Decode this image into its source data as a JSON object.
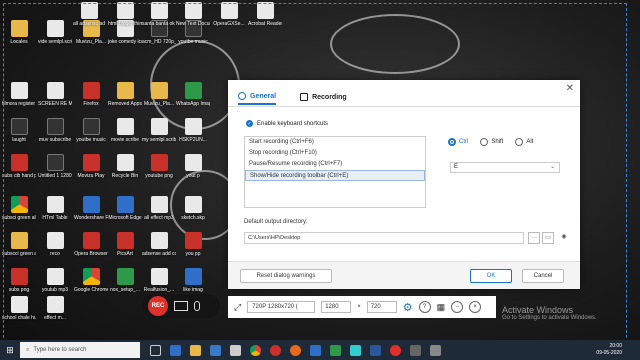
{
  "desktop": {
    "icons": [
      {
        "label": "Locales",
        "color": "c-folder"
      },
      {
        "label": "vide semlpl.scribe",
        "color": "c-file"
      },
      {
        "label": "Muvizu_Pla...",
        "color": "c-folder"
      },
      {
        "label": "joke comedy icon",
        "color": "c-file"
      },
      {
        "label": "acm_HD 720p_(1)",
        "color": "c-vid"
      },
      {
        "label": "youtbe music",
        "color": "c-vid"
      },
      {
        "label": "filmora register code",
        "color": "c-file"
      },
      {
        "label": "SCREEN RE MP3",
        "color": "c-file"
      },
      {
        "label": "Firefox",
        "color": "c-red"
      },
      {
        "label": "Removed Apps",
        "color": "c-folder"
      },
      {
        "label": "Muvizu_Pla...",
        "color": "c-folder"
      },
      {
        "label": "WhatsApp Image 2020...",
        "color": "c-green"
      },
      {
        "label": "laught",
        "color": "c-vid"
      },
      {
        "label": "muv subscribe",
        "color": "c-vid"
      },
      {
        "label": "youtbe music",
        "color": "c-vid"
      },
      {
        "label": "movie scribe",
        "color": "c-file"
      },
      {
        "label": "my semlpl.scribe",
        "color": "c-file"
      },
      {
        "label": "HSKP2UN...",
        "color": "c-file"
      },
      {
        "label": "subs cib hand png",
        "color": "c-red"
      },
      {
        "label": "Untitled 1 1280x720...",
        "color": "c-vid"
      },
      {
        "label": "Movizu Play",
        "color": "c-red"
      },
      {
        "label": "Recycle Bin",
        "color": "c-file"
      },
      {
        "label": "youtube png",
        "color": "c-red"
      },
      {
        "label": "yout p",
        "color": "c-file"
      },
      {
        "label": "subsci green all",
        "color": "c-chrome"
      },
      {
        "label": "HTml Table",
        "color": "c-file"
      },
      {
        "label": "Wondershare Filmora9",
        "color": "c-blue"
      },
      {
        "label": "Microsoft Edge",
        "color": "c-blue"
      },
      {
        "label": "all effect mp3",
        "color": "c-file"
      },
      {
        "label": "sketch.skp",
        "color": "c-file"
      },
      {
        "label": "subscci green all_files",
        "color": "c-folder"
      },
      {
        "label": "reco",
        "color": "c-file"
      },
      {
        "label": "Opera Browser",
        "color": "c-red"
      },
      {
        "label": "PicsArt",
        "color": "c-red"
      },
      {
        "label": "adsense add code",
        "color": "c-file"
      },
      {
        "label": "you pp",
        "color": "c-red"
      },
      {
        "label": "subs png",
        "color": "c-red"
      },
      {
        "label": "youtub mp3",
        "color": "c-file"
      },
      {
        "label": "Google Chrome",
        "color": "c-chrome"
      },
      {
        "label": "nox_setup_...",
        "color": "c-green"
      },
      {
        "label": "Realfusion_...",
        "color": "c-file"
      },
      {
        "label": "like imag",
        "color": "c-blue"
      },
      {
        "label": "school chale hum",
        "color": "c-file"
      },
      {
        "label": "effect m...",
        "color": "c-file"
      }
    ],
    "top_labels": [
      "all adsensc ad",
      "html bloger thims me",
      "santa banta ok filmora",
      "New Text Document",
      "OperaGXSe...",
      "Acrobat Reader DC"
    ]
  },
  "dialog": {
    "tabs": [
      {
        "label": "General"
      },
      {
        "label": "Recording"
      }
    ],
    "enable_shortcuts_label": "Enable keyboard shortcuts",
    "shortcuts": [
      "Start recording (Ctrl+F6)",
      "Stop recording (Ctrl+F10)",
      "Pause/Resume recording (Ctrl+F7)",
      "Show/Hide recording toolbar (Ctrl+E)"
    ],
    "selected_shortcut_index": 3,
    "modifiers": [
      {
        "label": "Ctrl",
        "selected": true
      },
      {
        "label": "Shift",
        "selected": false
      },
      {
        "label": "Alt",
        "selected": false
      }
    ],
    "key_value": "E",
    "output_dir_label": "Default output directory:",
    "output_dir_value": "C:\\Users\\HP\\Desktop",
    "reset_label": "Reset dialog warnings",
    "ok_label": "OK",
    "cancel_label": "Cancel"
  },
  "recorder": {
    "rec_label": "REC",
    "resolution": "720P 1280x720 (",
    "width": "1280",
    "height": "720",
    "times": "×"
  },
  "watermark": {
    "line1": "Activate Windows",
    "line2": "Go to Settings to activate Windows."
  },
  "taskbar": {
    "search_placeholder": "Type here to search",
    "time": "20:00",
    "date": "09-05-2020"
  },
  "colors": {
    "accent": "#1a73c9",
    "rec": "#e0302a",
    "taskbar": "#1e2a38"
  }
}
